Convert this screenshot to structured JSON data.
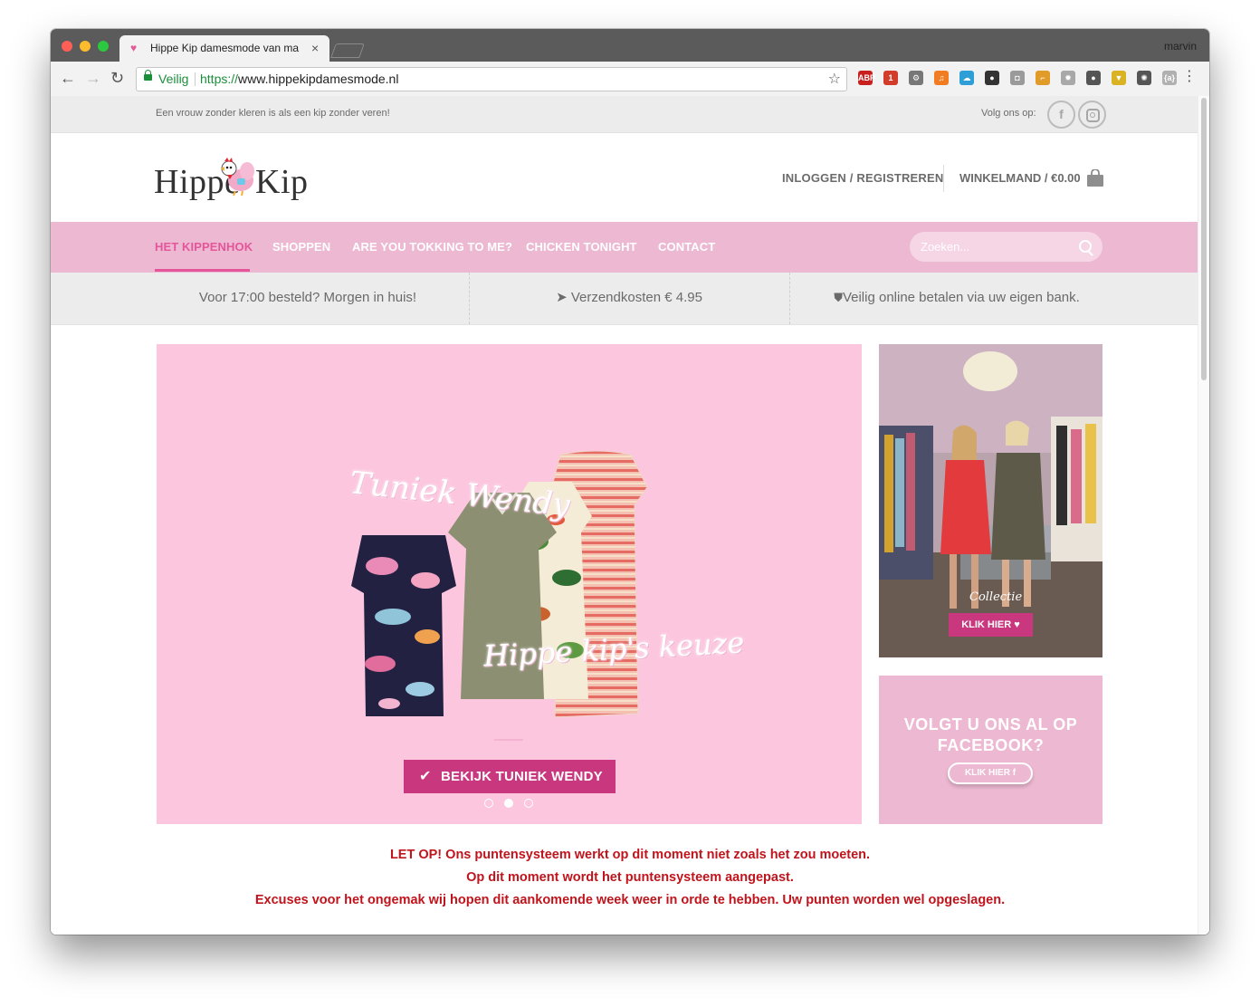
{
  "browser": {
    "tab_title": "Hippe Kip damesmode van ma",
    "tab_close": "×",
    "profile": "marvin",
    "secure_label": "Veilig",
    "url_scheme": "https://",
    "url_host": "www.hippekipdamesmode.nl",
    "extensions": [
      {
        "name": "abp-icon",
        "label": "ABP",
        "color": "#c8201f"
      },
      {
        "name": "counter-icon",
        "label": "1",
        "color": "#d33b2a"
      },
      {
        "name": "settings-icon",
        "label": "⚙",
        "color": "#777777"
      },
      {
        "name": "music-icon",
        "label": "♫",
        "color": "#f27c21"
      },
      {
        "name": "weather-icon",
        "label": "☁",
        "color": "#2e9fd6"
      },
      {
        "name": "flag-icon",
        "label": "●",
        "color": "#333333"
      },
      {
        "name": "camera-icon",
        "label": "◘",
        "color": "#9a9a9a"
      },
      {
        "name": "tool-icon",
        "label": "⌐",
        "color": "#e09b29"
      },
      {
        "name": "gear-icon",
        "label": "✹",
        "color": "#a8a8a8"
      },
      {
        "name": "circle-icon",
        "label": "●",
        "color": "#555555"
      },
      {
        "name": "shield-icon",
        "label": "▼",
        "color": "#d9b321"
      },
      {
        "name": "atom-icon",
        "label": "✺",
        "color": "#555555"
      },
      {
        "name": "code-icon",
        "label": "{a}",
        "color": "#b0b0b0"
      }
    ]
  },
  "topbar": {
    "tagline": "Een vrouw zonder kleren is als een kip zonder veren!",
    "follow_label": "Volg ons op:",
    "facebook_glyph": "f"
  },
  "header": {
    "logo_word_1": "Hippe",
    "logo_word_2": "Kip",
    "login": "INLOGGEN / REGISTREREN",
    "cart": "WINKELMAND / €0.00"
  },
  "nav": {
    "items": [
      "HET KIPPENHOK",
      "SHOPPEN",
      "ARE YOU TOKKING TO ME?",
      "CHICKEN TONIGHT",
      "CONTACT"
    ],
    "search_placeholder": "Zoeken..."
  },
  "usp": {
    "delivery": "Voor 17:00 besteld? Morgen in huis!",
    "shipping": "Verzendkosten € 4.95",
    "payment": "Veilig online betalen via uw eigen bank."
  },
  "hero": {
    "script_1": "Tuniek Wendy",
    "script_2": "Hippe kip's keuze",
    "button": "BEKIJK TUNIEK WENDY",
    "slide_count": 3,
    "active_slide": 2
  },
  "promo_photo": {
    "caption": "Collectie",
    "button": "KLIK HIER"
  },
  "facebook_box": {
    "title_line_1": "VOLGT U ONS AL OP",
    "title_line_2": "FACEBOOK?",
    "button": "KLIK HIER  f"
  },
  "notice": {
    "line_1": "LET OP! Ons puntensysteem werkt op dit moment niet zoals het zou moeten.",
    "line_2": "Op dit moment wordt het puntensysteem aangepast.",
    "line_3": "Excuses voor het ongemak wij hopen dit aankomende week weer in orde te hebben. Uw punten worden wel opgeslagen."
  },
  "colors": {
    "brand_pink": "#edb9d2",
    "accent_pink": "#e5559a",
    "button_magenta": "#c9377f",
    "hero_bg": "#fcc6df",
    "notice_red": "#c0141c"
  }
}
